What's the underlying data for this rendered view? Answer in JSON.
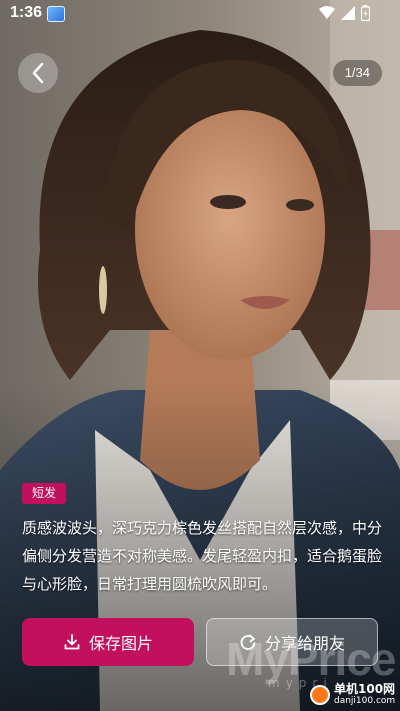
{
  "status_bar": {
    "time": "1:36"
  },
  "top": {
    "page_counter": "1/34"
  },
  "content": {
    "tag": "短发",
    "description": "质感波波头，深巧克力棕色发丝搭配自然层次感，中分偏侧分发营造不对称美感。发尾轻盈内扣，适合鹅蛋脸与心形脸，日常打理用圆梳吹风即可。"
  },
  "actions": {
    "save_label": "保存图片",
    "share_label": "分享给朋友"
  },
  "watermark": {
    "brand": "MyPrice",
    "brand_sub": "mypri",
    "site_name": "单机100网",
    "site_domain": "danji100.com"
  },
  "colors": {
    "accent": "#c2105e"
  }
}
